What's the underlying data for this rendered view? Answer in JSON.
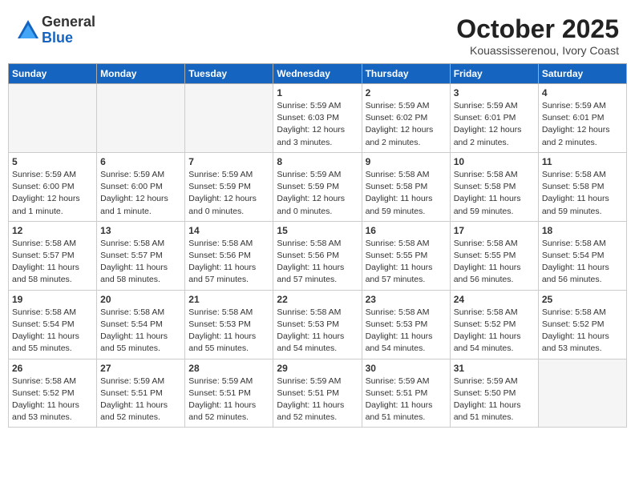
{
  "header": {
    "logo_general": "General",
    "logo_blue": "Blue",
    "month": "October 2025",
    "location": "Kouassisserenou, Ivory Coast"
  },
  "weekdays": [
    "Sunday",
    "Monday",
    "Tuesday",
    "Wednesday",
    "Thursday",
    "Friday",
    "Saturday"
  ],
  "weeks": [
    [
      {
        "day": "",
        "empty": true
      },
      {
        "day": "",
        "empty": true
      },
      {
        "day": "",
        "empty": true
      },
      {
        "day": "1",
        "sunrise": "5:59 AM",
        "sunset": "6:03 PM",
        "daylight": "12 hours and 3 minutes."
      },
      {
        "day": "2",
        "sunrise": "5:59 AM",
        "sunset": "6:02 PM",
        "daylight": "12 hours and 2 minutes."
      },
      {
        "day": "3",
        "sunrise": "5:59 AM",
        "sunset": "6:01 PM",
        "daylight": "12 hours and 2 minutes."
      },
      {
        "day": "4",
        "sunrise": "5:59 AM",
        "sunset": "6:01 PM",
        "daylight": "12 hours and 2 minutes."
      }
    ],
    [
      {
        "day": "5",
        "sunrise": "5:59 AM",
        "sunset": "6:00 PM",
        "daylight": "12 hours and 1 minute."
      },
      {
        "day": "6",
        "sunrise": "5:59 AM",
        "sunset": "6:00 PM",
        "daylight": "12 hours and 1 minute."
      },
      {
        "day": "7",
        "sunrise": "5:59 AM",
        "sunset": "5:59 PM",
        "daylight": "12 hours and 0 minutes."
      },
      {
        "day": "8",
        "sunrise": "5:59 AM",
        "sunset": "5:59 PM",
        "daylight": "12 hours and 0 minutes."
      },
      {
        "day": "9",
        "sunrise": "5:58 AM",
        "sunset": "5:58 PM",
        "daylight": "11 hours and 59 minutes."
      },
      {
        "day": "10",
        "sunrise": "5:58 AM",
        "sunset": "5:58 PM",
        "daylight": "11 hours and 59 minutes."
      },
      {
        "day": "11",
        "sunrise": "5:58 AM",
        "sunset": "5:58 PM",
        "daylight": "11 hours and 59 minutes."
      }
    ],
    [
      {
        "day": "12",
        "sunrise": "5:58 AM",
        "sunset": "5:57 PM",
        "daylight": "11 hours and 58 minutes."
      },
      {
        "day": "13",
        "sunrise": "5:58 AM",
        "sunset": "5:57 PM",
        "daylight": "11 hours and 58 minutes."
      },
      {
        "day": "14",
        "sunrise": "5:58 AM",
        "sunset": "5:56 PM",
        "daylight": "11 hours and 57 minutes."
      },
      {
        "day": "15",
        "sunrise": "5:58 AM",
        "sunset": "5:56 PM",
        "daylight": "11 hours and 57 minutes."
      },
      {
        "day": "16",
        "sunrise": "5:58 AM",
        "sunset": "5:55 PM",
        "daylight": "11 hours and 57 minutes."
      },
      {
        "day": "17",
        "sunrise": "5:58 AM",
        "sunset": "5:55 PM",
        "daylight": "11 hours and 56 minutes."
      },
      {
        "day": "18",
        "sunrise": "5:58 AM",
        "sunset": "5:54 PM",
        "daylight": "11 hours and 56 minutes."
      }
    ],
    [
      {
        "day": "19",
        "sunrise": "5:58 AM",
        "sunset": "5:54 PM",
        "daylight": "11 hours and 55 minutes."
      },
      {
        "day": "20",
        "sunrise": "5:58 AM",
        "sunset": "5:54 PM",
        "daylight": "11 hours and 55 minutes."
      },
      {
        "day": "21",
        "sunrise": "5:58 AM",
        "sunset": "5:53 PM",
        "daylight": "11 hours and 55 minutes."
      },
      {
        "day": "22",
        "sunrise": "5:58 AM",
        "sunset": "5:53 PM",
        "daylight": "11 hours and 54 minutes."
      },
      {
        "day": "23",
        "sunrise": "5:58 AM",
        "sunset": "5:53 PM",
        "daylight": "11 hours and 54 minutes."
      },
      {
        "day": "24",
        "sunrise": "5:58 AM",
        "sunset": "5:52 PM",
        "daylight": "11 hours and 54 minutes."
      },
      {
        "day": "25",
        "sunrise": "5:58 AM",
        "sunset": "5:52 PM",
        "daylight": "11 hours and 53 minutes."
      }
    ],
    [
      {
        "day": "26",
        "sunrise": "5:58 AM",
        "sunset": "5:52 PM",
        "daylight": "11 hours and 53 minutes."
      },
      {
        "day": "27",
        "sunrise": "5:59 AM",
        "sunset": "5:51 PM",
        "daylight": "11 hours and 52 minutes."
      },
      {
        "day": "28",
        "sunrise": "5:59 AM",
        "sunset": "5:51 PM",
        "daylight": "11 hours and 52 minutes."
      },
      {
        "day": "29",
        "sunrise": "5:59 AM",
        "sunset": "5:51 PM",
        "daylight": "11 hours and 52 minutes."
      },
      {
        "day": "30",
        "sunrise": "5:59 AM",
        "sunset": "5:51 PM",
        "daylight": "11 hours and 51 minutes."
      },
      {
        "day": "31",
        "sunrise": "5:59 AM",
        "sunset": "5:50 PM",
        "daylight": "11 hours and 51 minutes."
      },
      {
        "day": "",
        "empty": true
      }
    ]
  ],
  "labels": {
    "sunrise": "Sunrise:",
    "sunset": "Sunset:",
    "daylight": "Daylight:"
  }
}
